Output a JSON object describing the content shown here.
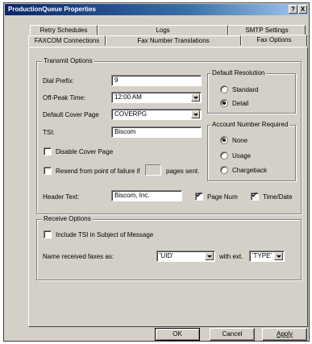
{
  "window": {
    "title": "ProductionQueue Properties",
    "help_btn": "?",
    "close_btn": "X"
  },
  "tabs": {
    "row1": [
      "Retry Schedules",
      "Logs",
      "SMTP Settings"
    ],
    "row2": [
      "FAXCOM Connections",
      "Fax Number Translations",
      "Fax Options"
    ],
    "active": "Fax Options"
  },
  "transmit": {
    "legend": "Transmit Options",
    "dial_prefix_label": "Dial Prefix:",
    "dial_prefix_value": "9",
    "off_peak_label": "Off-Peak Time:",
    "off_peak_value": "12:00 AM",
    "cover_page_label": "Default Cover Page",
    "cover_page_value": "COVERPG",
    "tsi_label": "TSI:",
    "tsi_value": "Biscom",
    "disable_cover_label": "Disable Cover Page",
    "disable_cover_checked": false,
    "resend_label": "Resend from point of failure if",
    "resend_checked": false,
    "pages_sent_label": "pages sent.",
    "header_text_label": "Header Text:",
    "header_text_value": "Biscom, Inc.",
    "page_num_label": "Page Num",
    "page_num_checked": true,
    "time_date_label": "Time/Date",
    "time_date_checked": true
  },
  "resolution": {
    "legend": "Default Resolution",
    "options": [
      "Standard",
      "Detail"
    ],
    "selected": "Detail"
  },
  "account": {
    "legend": "Account Number Required",
    "options": [
      "None",
      "Usage",
      "Chargeback"
    ],
    "selected": "None"
  },
  "receive": {
    "legend": "Receive Options",
    "include_tsi_label": "Include TSI in Subject of Message",
    "include_tsi_checked": false,
    "name_label": "Name received faxes as:",
    "name_value": "'UID'",
    "with_ext_label": "with ext.",
    "ext_value": "'TYPE'"
  },
  "buttons": {
    "ok": "OK",
    "cancel": "Cancel",
    "apply": "Apply"
  }
}
